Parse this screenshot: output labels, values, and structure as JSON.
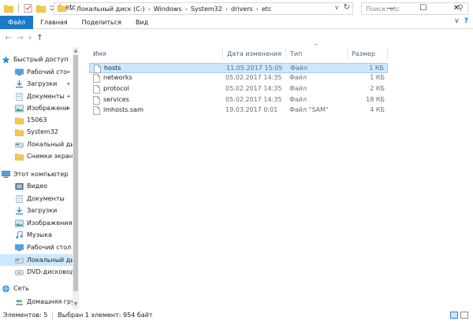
{
  "window": {
    "title": "etc",
    "minimize": "—",
    "maximize": "☐",
    "close": "✕"
  },
  "ribbon": {
    "tabs": [
      "Файл",
      "Главная",
      "Поделиться",
      "Вид"
    ],
    "collapse": "∨",
    "help": "?"
  },
  "address": {
    "back": "←",
    "forward": "→",
    "recent": "∨",
    "up": "↑",
    "root_chevron": "«",
    "crumbs": [
      "Локальный диск (C:)",
      "Windows",
      "System32",
      "drivers",
      "etc"
    ],
    "search_placeholder": "Поиск: etc"
  },
  "nav": {
    "items": [
      {
        "label": "Быстрый доступ",
        "icon": "star-icon",
        "pinned": false
      },
      {
        "label": "Рабочий сто",
        "icon": "desktop-icon",
        "pinned": true
      },
      {
        "label": "Загрузки",
        "icon": "download-icon",
        "pinned": true
      },
      {
        "label": "Документы",
        "icon": "documents-icon",
        "pinned": true
      },
      {
        "label": "Изображени",
        "icon": "pictures-icon",
        "pinned": true
      },
      {
        "label": "15063",
        "icon": "folder-icon",
        "pinned": false
      },
      {
        "label": "System32",
        "icon": "folder-icon",
        "pinned": false
      },
      {
        "label": "Локальный дис",
        "icon": "drive-icon",
        "pinned": false
      },
      {
        "label": "Снимки экрана",
        "icon": "folder-icon",
        "pinned": false
      },
      {
        "label": "Этот компьютер",
        "icon": "computer-icon",
        "pinned": false
      },
      {
        "label": "Видео",
        "icon": "video-icon",
        "pinned": false
      },
      {
        "label": "Документы",
        "icon": "documents-icon",
        "pinned": false
      },
      {
        "label": "Загрузки",
        "icon": "download-icon",
        "pinned": false
      },
      {
        "label": "Изображения",
        "icon": "pictures-icon",
        "pinned": false
      },
      {
        "label": "Музыка",
        "icon": "music-icon",
        "pinned": false
      },
      {
        "label": "Рабочий стол",
        "icon": "desktop-icon",
        "pinned": false
      },
      {
        "label": "Локальный дис",
        "icon": "drive-icon",
        "pinned": false
      },
      {
        "label": "DVD-дисковод (",
        "icon": "dvd-icon",
        "pinned": false
      },
      {
        "label": "Сеть",
        "icon": "network-icon",
        "pinned": false
      },
      {
        "label": "Домашняя груп",
        "icon": "homegroup-icon",
        "pinned": false
      }
    ],
    "pin_glyph": "📌"
  },
  "columns": {
    "name": "Имя",
    "date": "Дата изменения",
    "type": "Тип",
    "size": "Размер",
    "sort_arrow": "^"
  },
  "files": [
    {
      "name": "hosts",
      "date": "11.05.2017 15:05",
      "type": "Файл",
      "size": "1 КБ",
      "selected": true
    },
    {
      "name": "networks",
      "date": "05.02.2017 14:35",
      "type": "Файл",
      "size": "1 КБ",
      "selected": false
    },
    {
      "name": "protocol",
      "date": "05.02.2017 14:35",
      "type": "Файл",
      "size": "2 КБ",
      "selected": false
    },
    {
      "name": "services",
      "date": "05.02.2017 14:35",
      "type": "Файл",
      "size": "18 КБ",
      "selected": false
    },
    {
      "name": "lmhosts.sam",
      "date": "19.03.2017 0:01",
      "type": "Файл \"SAM\"",
      "size": "4 КБ",
      "selected": false
    }
  ],
  "status": {
    "items_count": "Элементов: 5",
    "selection": "Выбран 1 элемент: 954 байт"
  },
  "colors": {
    "accent": "#1979ca",
    "selection": "#cce8ff",
    "selection_border": "#99d1ff",
    "folder": "#f5c84c"
  }
}
